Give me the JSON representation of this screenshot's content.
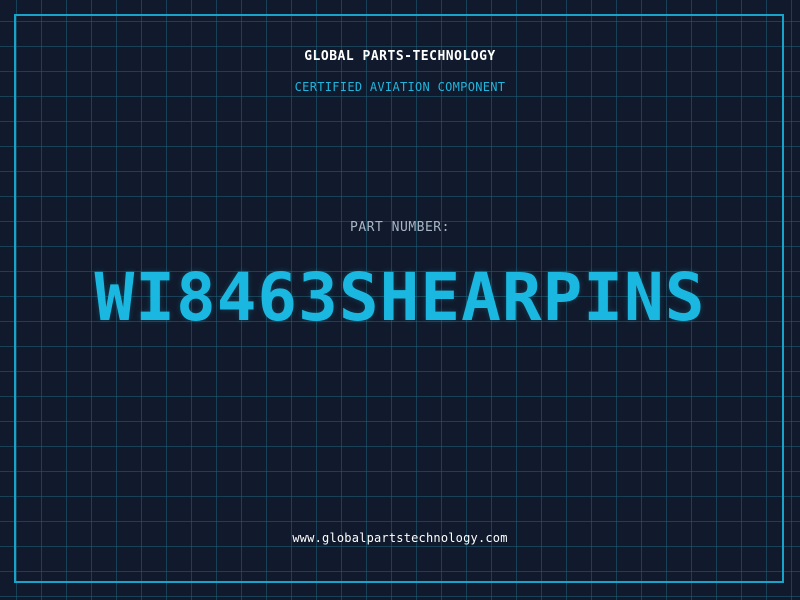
{
  "header": {
    "company_name": "GLOBAL PARTS-TECHNOLOGY",
    "tagline": "CERTIFIED AVIATION COMPONENT"
  },
  "part": {
    "label": "PART NUMBER:",
    "number": "WI8463SHEARPINS"
  },
  "footer": {
    "website": "www.globalpartstechnology.com"
  },
  "colors": {
    "background": "#101a2c",
    "grid": "#206078",
    "accent": "#1ab8e0",
    "frame": "#1aa3c8"
  }
}
